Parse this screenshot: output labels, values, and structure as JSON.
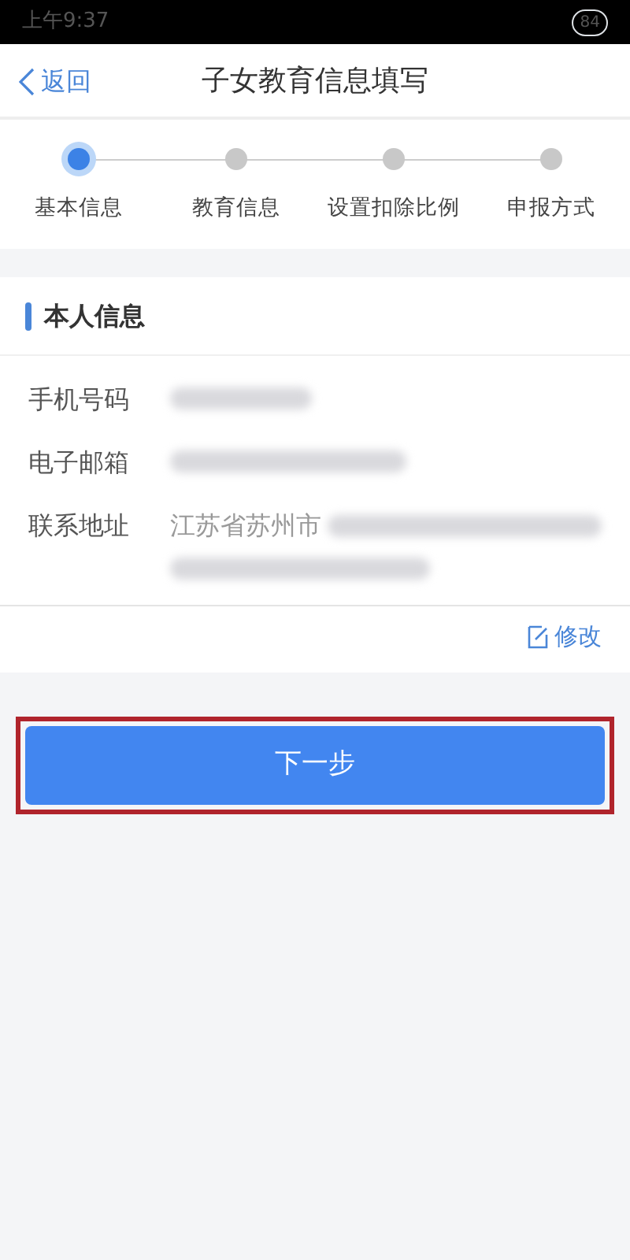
{
  "status_bar": {
    "time": "上午9:37",
    "battery": "84"
  },
  "header": {
    "back": "返回",
    "title": "子女教育信息填写"
  },
  "steps": [
    {
      "label": "基本信息",
      "selected": true
    },
    {
      "label": "教育信息",
      "selected": false
    },
    {
      "label": "设置扣除比例",
      "selected": false
    },
    {
      "label": "申报方式",
      "selected": false
    }
  ],
  "section": {
    "title": "本人信息",
    "fields": [
      {
        "label": "手机号码",
        "kind": "blurred"
      },
      {
        "label": "电子邮箱",
        "kind": "blurred"
      },
      {
        "label": "联系地址",
        "kind": "partly_blurred",
        "value": "江苏省苏州市"
      }
    ]
  },
  "edit_link": "修改",
  "next_button": {
    "label": "下一步",
    "highlighted": true
  }
}
